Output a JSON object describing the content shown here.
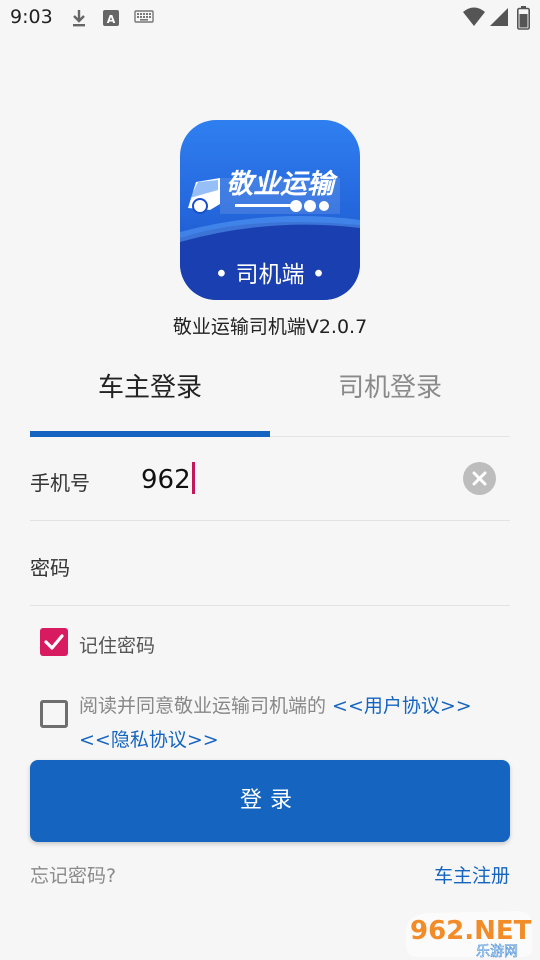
{
  "status_bar": {
    "time": "9:03",
    "icons": [
      "download-icon",
      "a-notification-icon",
      "keyboard-icon"
    ],
    "right_icons": [
      "wifi-icon",
      "signal-icon",
      "battery-icon"
    ]
  },
  "app": {
    "logo_text": "敬业运输",
    "logo_sub": "• 司机端 •",
    "name": "敬业运输司机端V2.0.7",
    "brand_color": "#1565c0"
  },
  "tabs": [
    {
      "label": "车主登录",
      "active": true
    },
    {
      "label": "司机登录",
      "active": false
    }
  ],
  "form": {
    "phone_label": "手机号",
    "phone_value": "962",
    "password_label": "密码",
    "remember_label": "记住密码",
    "remember_checked": true,
    "agree_checked": false,
    "agree_prefix": "阅读并同意敬业运输司机端的 ",
    "user_agreement": "<<用户协议>>",
    "privacy_agreement": "<<隐私协议>>"
  },
  "login_button": "登录",
  "forgot_password": "忘记密码?",
  "owner_register": "车主注册",
  "watermark": {
    "brand": "962.NET",
    "sub": "乐游网"
  }
}
